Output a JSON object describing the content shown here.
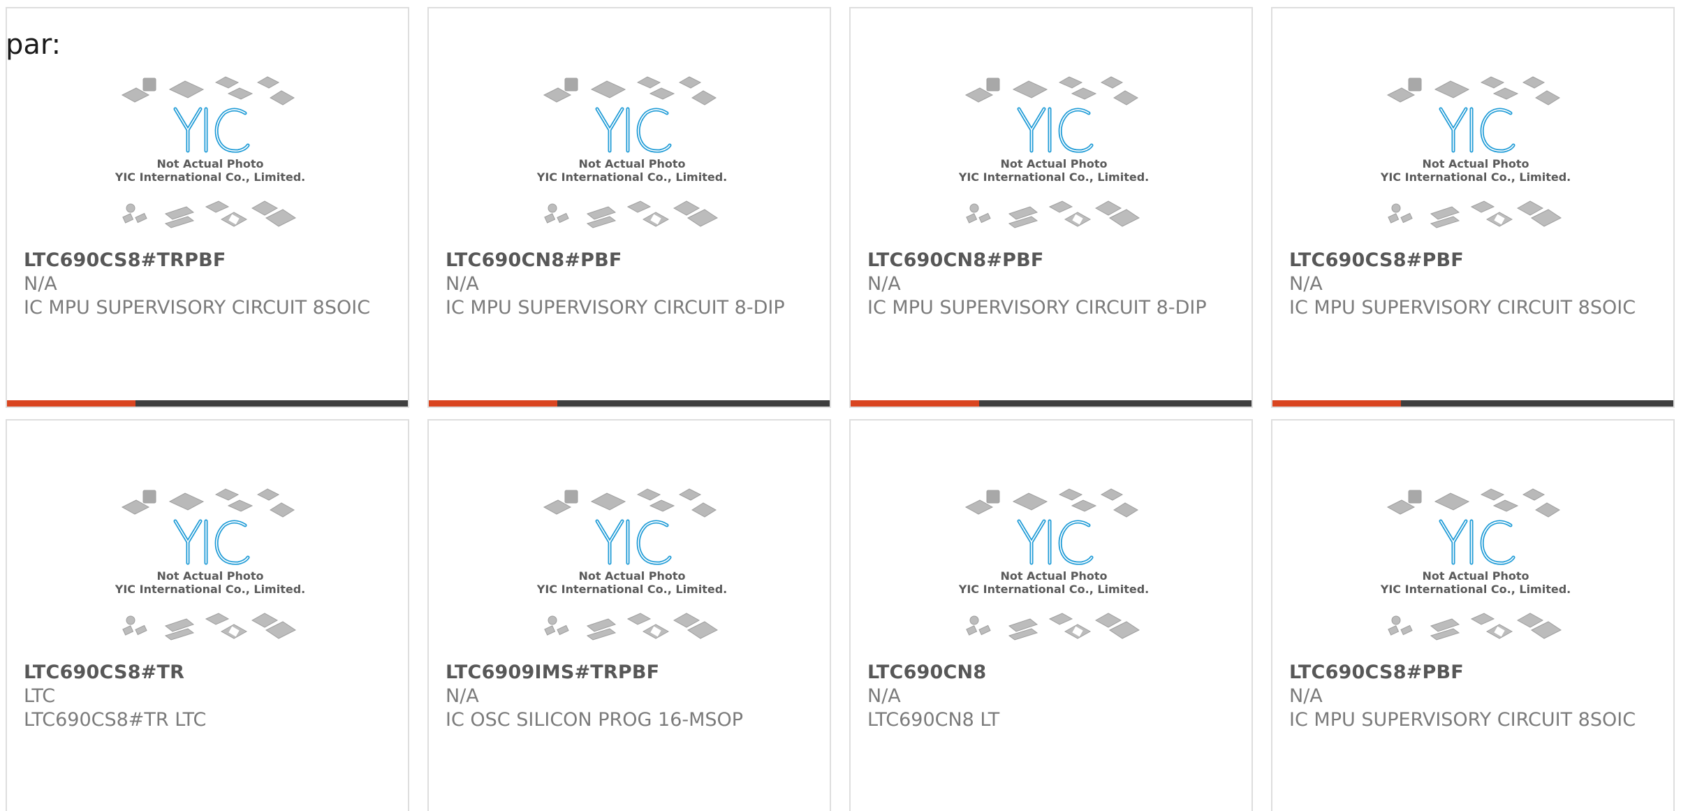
{
  "header": {
    "label": "par:"
  },
  "photo": {
    "brand": "YIC",
    "line1": "Not Actual Photo",
    "line2": "YIC International Co., Limited."
  },
  "colors": {
    "accent": "#d94520",
    "bar": "#3e3e3e",
    "logo": "#1c9ad6"
  },
  "products": [
    {
      "part": "LTC690CS8#TRPBF",
      "mfr": "N/A",
      "desc": "IC MPU SUPERVISORY CIRCUIT 8SOIC"
    },
    {
      "part": "LTC690CN8#PBF",
      "mfr": "N/A",
      "desc": "IC MPU SUPERVISORY CIRCUIT 8-DIP"
    },
    {
      "part": "LTC690CN8#PBF",
      "mfr": "N/A",
      "desc": "IC MPU SUPERVISORY CIRCUIT 8-DIP"
    },
    {
      "part": "LTC690CS8#PBF",
      "mfr": "N/A",
      "desc": "IC MPU SUPERVISORY CIRCUIT 8SOIC"
    },
    {
      "part": "LTC690CS8#TR",
      "mfr": "LTC",
      "desc": "LTC690CS8#TR LTC"
    },
    {
      "part": "LTC6909IMS#TRPBF",
      "mfr": "N/A",
      "desc": "IC OSC SILICON PROG 16-MSOP"
    },
    {
      "part": "LTC690CN8",
      "mfr": "N/A",
      "desc": "LTC690CN8 LT"
    },
    {
      "part": "LTC690CS8#PBF",
      "mfr": "N/A",
      "desc": "IC MPU SUPERVISORY CIRCUIT 8SOIC"
    }
  ]
}
